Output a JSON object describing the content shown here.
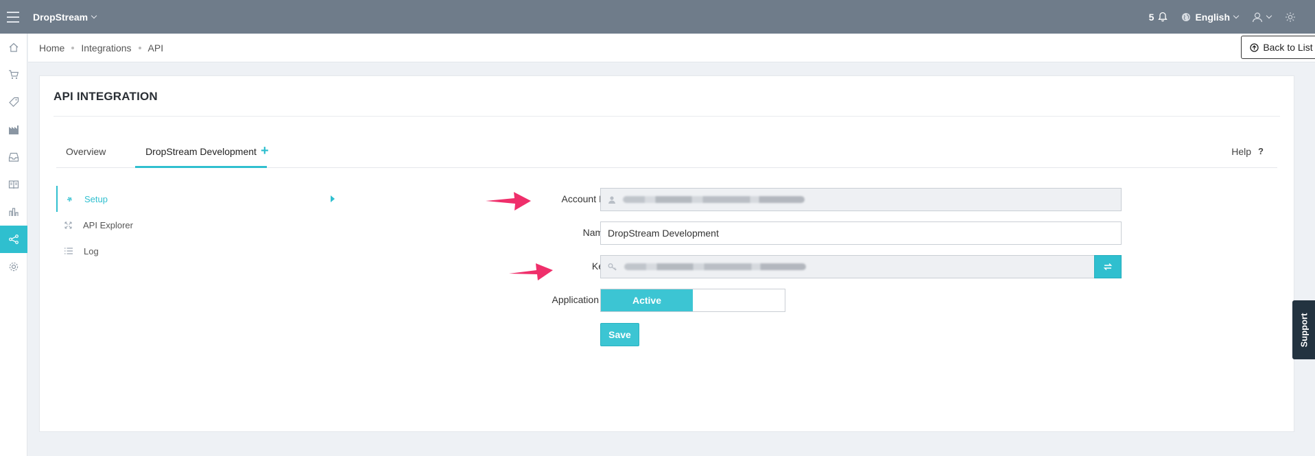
{
  "topbar": {
    "brand": "DropStream",
    "notification_count": "5",
    "language": "English"
  },
  "sidebar": {
    "icons": [
      "home-icon",
      "cart-icon",
      "tag-icon",
      "factory-icon",
      "inbox-icon",
      "book-icon",
      "bar-chart-icon",
      "share-icon",
      "settings-icon"
    ],
    "active": "share-icon"
  },
  "breadcrumb": [
    "Home",
    "Integrations",
    "API"
  ],
  "back_button": "Back to List",
  "panel": {
    "title": "API INTEGRATION",
    "tabs": [
      "Overview",
      "DropStream Development"
    ],
    "active_tab": "DropStream Development",
    "help": "Help",
    "help_icon": "?"
  },
  "subnav": [
    {
      "label": "Setup",
      "icon": "gear-icon",
      "active": true
    },
    {
      "label": "API Explorer",
      "icon": "expand-icon",
      "active": false
    },
    {
      "label": "Log",
      "icon": "list-icon",
      "active": false
    }
  ],
  "form": {
    "account_id_label": "Account ID",
    "name_label": "Name",
    "name_value": "DropStream Development",
    "key_label": "Key",
    "application_label": "Application is",
    "status": "Active",
    "save": "Save"
  },
  "support": "Support",
  "colors": {
    "accent": "#2fbfcf",
    "topbar": "#6f7c8a",
    "arrow": "#ef2f6b"
  }
}
